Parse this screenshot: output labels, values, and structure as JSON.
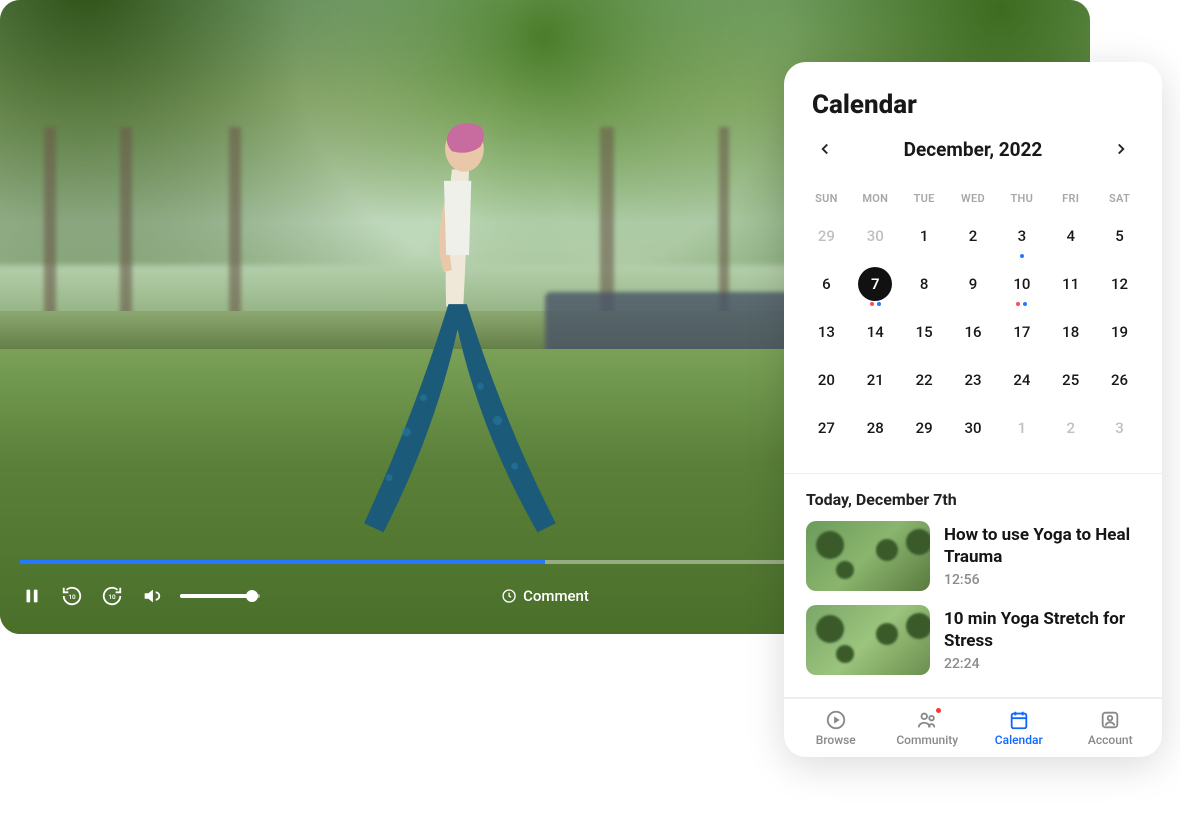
{
  "player": {
    "comment_label": "Comment",
    "progress_percent": 50,
    "volume_percent": 90
  },
  "calendar": {
    "title": "Calendar",
    "month_label": "December, 2022",
    "dow": [
      "SUN",
      "MON",
      "TUE",
      "WED",
      "THU",
      "FRI",
      "SAT"
    ],
    "weeks": [
      [
        {
          "d": "29",
          "other": true
        },
        {
          "d": "30",
          "other": true
        },
        {
          "d": "1"
        },
        {
          "d": "2"
        },
        {
          "d": "3",
          "dots": [
            "blue"
          ]
        },
        {
          "d": "4"
        },
        {
          "d": "5"
        }
      ],
      [
        {
          "d": "6"
        },
        {
          "d": "7",
          "selected": true,
          "dots": [
            "red",
            "blue"
          ]
        },
        {
          "d": "8"
        },
        {
          "d": "9"
        },
        {
          "d": "10",
          "dots": [
            "red",
            "blue"
          ]
        },
        {
          "d": "11"
        },
        {
          "d": "12"
        }
      ],
      [
        {
          "d": "13"
        },
        {
          "d": "14"
        },
        {
          "d": "15"
        },
        {
          "d": "16"
        },
        {
          "d": "17"
        },
        {
          "d": "18"
        },
        {
          "d": "19"
        }
      ],
      [
        {
          "d": "20"
        },
        {
          "d": "21"
        },
        {
          "d": "22"
        },
        {
          "d": "23"
        },
        {
          "d": "24"
        },
        {
          "d": "25"
        },
        {
          "d": "26"
        }
      ],
      [
        {
          "d": "27"
        },
        {
          "d": "28"
        },
        {
          "d": "29"
        },
        {
          "d": "30"
        },
        {
          "d": "1",
          "other": true
        },
        {
          "d": "2",
          "other": true
        },
        {
          "d": "3",
          "other": true
        }
      ]
    ]
  },
  "events": {
    "heading": "Today, December 7th",
    "list": [
      {
        "title": "How to use Yoga to Heal Trauma",
        "time": "12:56"
      },
      {
        "title": "10 min Yoga Stretch for Stress",
        "time": "22:24"
      }
    ]
  },
  "nav": {
    "items": [
      {
        "key": "browse",
        "label": "Browse"
      },
      {
        "key": "community",
        "label": "Community",
        "badge": true
      },
      {
        "key": "calendar",
        "label": "Calendar",
        "active": true
      },
      {
        "key": "account",
        "label": "Account"
      }
    ]
  },
  "colors": {
    "accent": "#1066ff",
    "dot_blue": "#2579ff",
    "dot_red": "#ff4b55"
  }
}
